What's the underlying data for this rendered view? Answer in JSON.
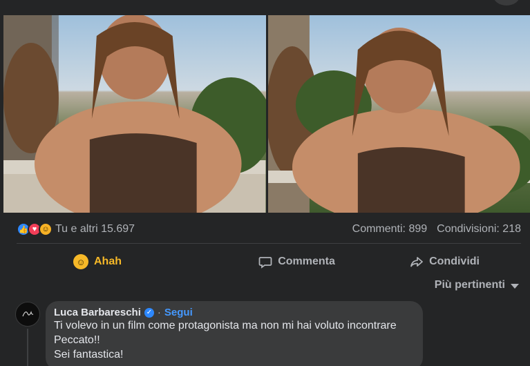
{
  "post": {
    "photos": [
      {
        "icon": "photo-left"
      },
      {
        "icon": "photo-right"
      }
    ],
    "reactions_text": "Tu e altri 15.697",
    "reaction_icons": [
      "like-icon",
      "love-icon",
      "haha-icon"
    ],
    "comments_count": "Commenti: 899",
    "shares_count": "Condivisioni: 218"
  },
  "actions": {
    "reaction_label": "Ahah",
    "comment_label": "Commenta",
    "share_label": "Condividi"
  },
  "sort": {
    "label": "Più pertinenti"
  },
  "comment": {
    "author": "Luca Barbareschi",
    "separator": "·",
    "follow_label": "Segui",
    "lines": [
      "Ti volevo in un film come protagonista ma non mi hai voluto incontrare",
      "Peccato!!",
      "Sei fantastica!"
    ]
  },
  "colors": {
    "background": "#242526",
    "bubble": "#3a3b3c",
    "accent_blue": "#4599ff",
    "haha_yellow": "#f7b928"
  }
}
